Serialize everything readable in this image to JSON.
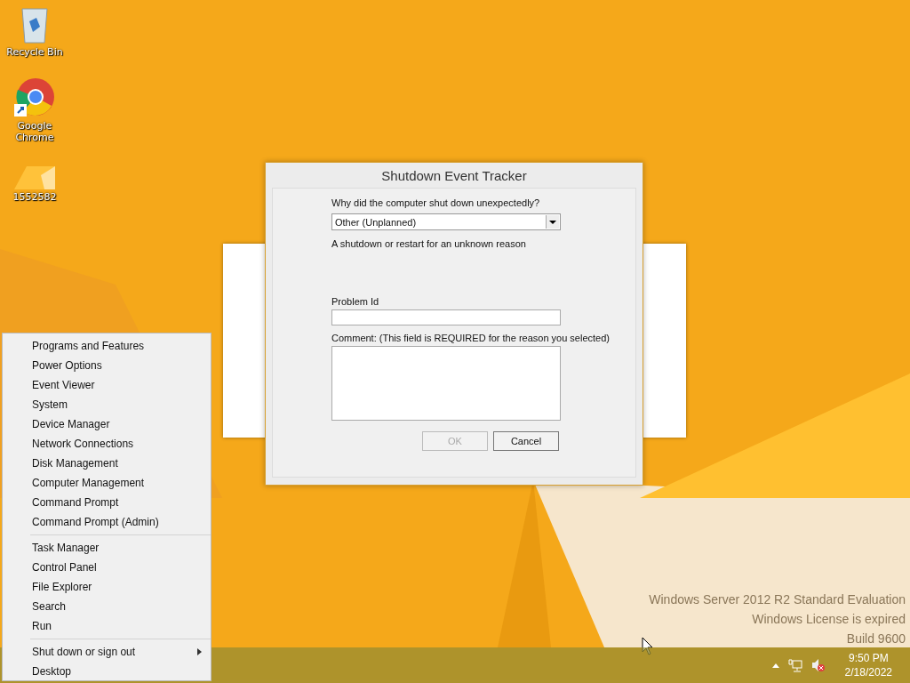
{
  "desktop_icons": [
    {
      "kind": "recycle",
      "label": "Recycle Bin"
    },
    {
      "kind": "chrome",
      "label": "Google Chrome"
    },
    {
      "kind": "folder",
      "label": "1552582"
    }
  ],
  "dialog": {
    "title": "Shutdown Event Tracker",
    "question": "Why did the computer shut down unexpectedly?",
    "reason": "Other (Unplanned)",
    "description": "A shutdown or restart for an unknown reason",
    "problem_id_label": "Problem Id",
    "comment_label": "Comment: (This field is REQUIRED for the reason you selected)",
    "buttons": [
      {
        "label": "OK",
        "disabled": true
      },
      {
        "label": "Cancel",
        "disabled": false
      }
    ]
  },
  "context_menu": {
    "groups": [
      [
        {
          "label": "Programs and Features",
          "submenu": false
        },
        {
          "label": "Power Options",
          "submenu": false
        },
        {
          "label": "Event Viewer",
          "submenu": false
        },
        {
          "label": "System",
          "submenu": false
        },
        {
          "label": "Device Manager",
          "submenu": false
        },
        {
          "label": "Network Connections",
          "submenu": false
        },
        {
          "label": "Disk Management",
          "submenu": false
        },
        {
          "label": "Computer Management",
          "submenu": false
        },
        {
          "label": "Command Prompt",
          "submenu": false
        },
        {
          "label": "Command Prompt (Admin)",
          "submenu": false
        }
      ],
      [
        {
          "label": "Task Manager",
          "submenu": false
        },
        {
          "label": "Control Panel",
          "submenu": false
        },
        {
          "label": "File Explorer",
          "submenu": false
        },
        {
          "label": "Search",
          "submenu": false
        },
        {
          "label": "Run",
          "submenu": false
        }
      ],
      [
        {
          "label": "Shut down or sign out",
          "submenu": true
        },
        {
          "label": "Desktop",
          "submenu": false
        }
      ]
    ]
  },
  "watermark": [
    "Windows Server 2012 R2 Standard Evaluation",
    "Windows License is expired",
    "Build 9600"
  ],
  "taskbar": {
    "time": "9:50 PM",
    "date": "2/18/2022"
  }
}
